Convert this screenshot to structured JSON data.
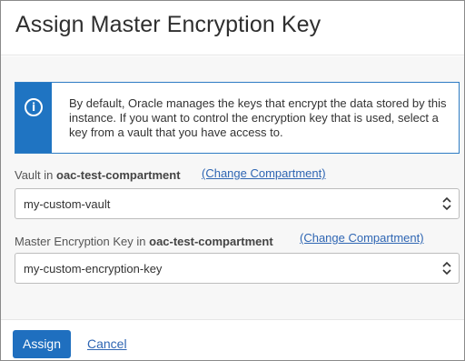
{
  "dialog": {
    "title": "Assign Master Encryption Key"
  },
  "info": {
    "icon": "info-icon",
    "text": "By default, Oracle manages the keys that encrypt the data stored by this instance. If you want to control the encryption key that is used, select a key from a vault that you have access to."
  },
  "vault": {
    "label_prefix": "Vault in ",
    "compartment": "oac-test-compartment",
    "change_link": "(Change Compartment)",
    "selected": "my-custom-vault"
  },
  "key": {
    "label_prefix": "Master Encryption Key in ",
    "compartment": "oac-test-compartment",
    "change_link": "(Change Compartment)",
    "selected": "my-custom-encryption-key"
  },
  "footer": {
    "assign_label": "Assign",
    "cancel_label": "Cancel"
  },
  "colors": {
    "primary": "#1f6fbf",
    "info_accent": "#1f74c2",
    "link": "#2f66b3"
  }
}
